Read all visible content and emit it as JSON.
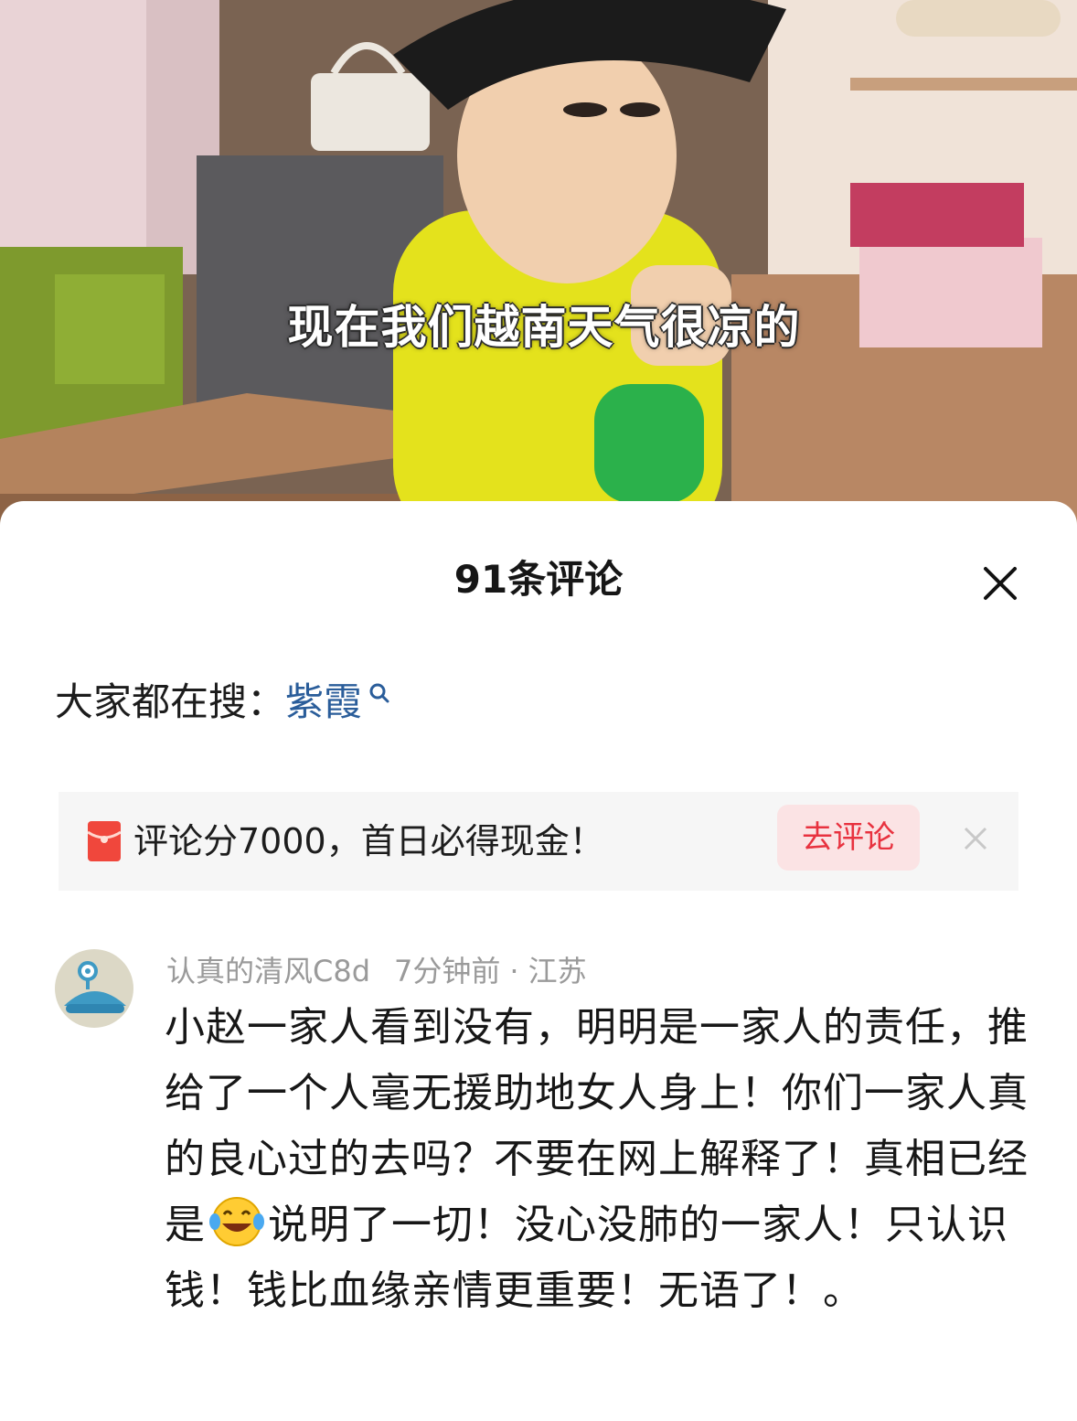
{
  "video": {
    "subtitle": "现在我们越南天气很凉的"
  },
  "comments_sheet": {
    "title": "91条评论",
    "hot_search": {
      "label": "大家都在搜：",
      "keyword": "紫霞"
    },
    "promo": {
      "text": "评论分7000，首日必得现金！",
      "button_label": "去评论"
    },
    "comments": [
      {
        "author": "认真的清风C8d",
        "time": "7分钟前",
        "location": "江苏",
        "text_before_emoji": "小赵一家人看到没有，明明是一家人的责任，推给了一个人毫无援助地女人身上！你们一家人真的良心过的去吗？不要在网上解释了！真相已经是",
        "emoji": "laughing-tears-emoji",
        "text_after_emoji": "说明了一切！没心没肺的一家人！只认识钱！钱比血缘亲情更重要！无语了！。"
      }
    ]
  },
  "colors": {
    "keyword_blue": "#2a5d9a",
    "promo_red": "#e8323f",
    "promo_button_bg": "#fbe3e4",
    "meta_gray": "#9a9a9a"
  }
}
